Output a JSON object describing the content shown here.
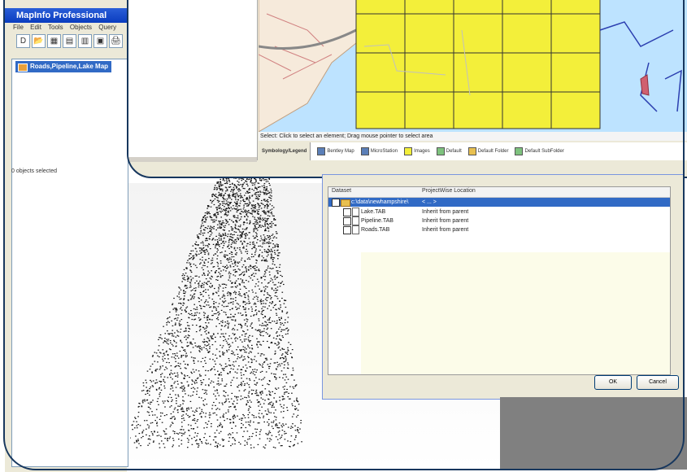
{
  "mapinfo": {
    "title": "MapInfo Professional",
    "menu": [
      "File",
      "Edit",
      "Tools",
      "Objects",
      "Query"
    ],
    "toolbar": [
      "D",
      "📂",
      "▦",
      "▤",
      "▥",
      "▣",
      "🖨"
    ],
    "tree_item": "Roads,Pipeline,Lake Map",
    "objects_selected": "0 objects selected"
  },
  "mapwindow": {
    "status": "Select: Click to select an element; Drag mouse pointer to select area",
    "legend_tab": "Symbology/Legend",
    "legend_items": [
      {
        "label": "Bentley Map",
        "color": "#5b7fb8"
      },
      {
        "label": "MicroStation",
        "color": "#5b7fb8"
      },
      {
        "label": "Images",
        "color": "#f3ef3a"
      },
      {
        "label": "Default",
        "color": "#7ec27e"
      },
      {
        "label": "Default Folder",
        "color": "#e8c050"
      },
      {
        "label": "Default SubFolder",
        "color": "#7ec27e"
      }
    ]
  },
  "dialog": {
    "col_dataset": "Dataset",
    "col_location": "ProjectWise Location",
    "rows": [
      {
        "dataset": "c:\\data\\newhampshire\\",
        "location": "< ... >",
        "selected": true
      },
      {
        "dataset": "Lake.TAB",
        "location": "Inherit from parent",
        "selected": false
      },
      {
        "dataset": "Pipeline.TAB",
        "location": "Inherit from parent",
        "selected": false
      },
      {
        "dataset": "Roads.TAB",
        "location": "Inherit from parent",
        "selected": false
      }
    ],
    "ok": "OK",
    "cancel": "Cancel"
  },
  "colors": {
    "frame": "#17375e",
    "map_water": "#bde3ff",
    "map_grid_fill": "#f3ef3a",
    "selection": "#316ac5"
  }
}
